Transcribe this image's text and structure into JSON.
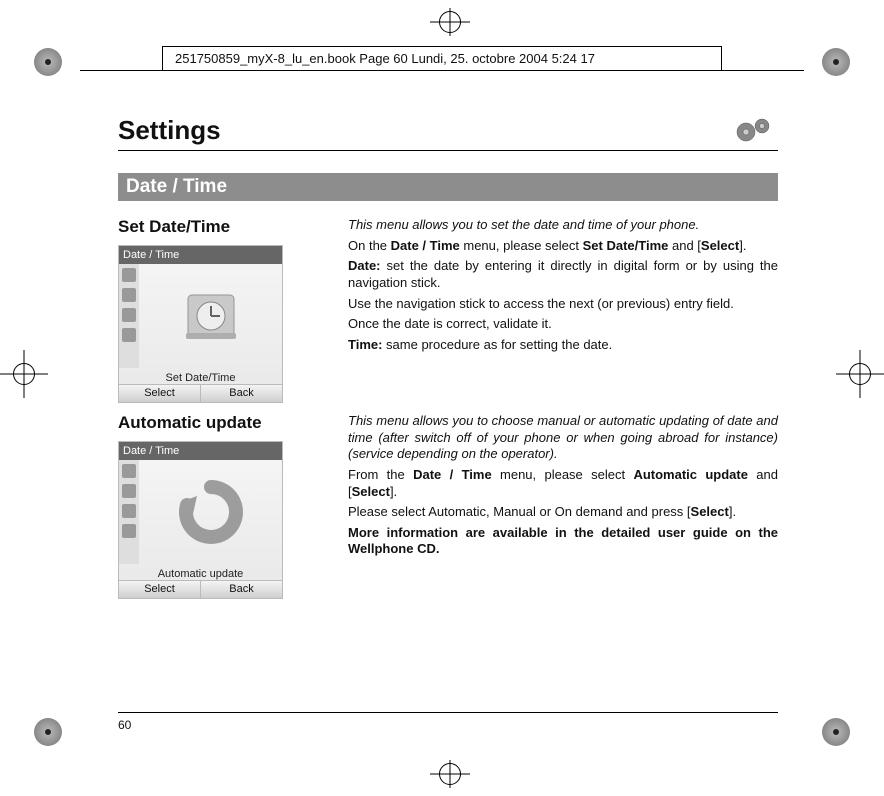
{
  "header": {
    "running_head": "251750859_myX-8_lu_en.book  Page 60  Lundi, 25. octobre 2004  5:24 17"
  },
  "page": {
    "title": "Settings",
    "number": "60"
  },
  "section": {
    "title": "Date / Time"
  },
  "set_date_time": {
    "heading": "Set Date/Time",
    "phone_title": "Date / Time",
    "phone_caption": "Set Date/Time",
    "soft_left": "Select",
    "soft_right": "Back",
    "p_intro": "This menu allows you to set the date and time of your phone.",
    "p_on_pre": "On the ",
    "p_on_menu": "Date / Time",
    "p_on_mid": " menu, please select ",
    "p_on_sel": "Set Date/Time",
    "p_on_and": " and [",
    "p_on_btn": "Select",
    "p_on_end": "].",
    "p_date_label": "Date:",
    "p_date_body": " set the date by entering it directly in digital form or by using the navigation stick.",
    "p_nav": "Use the navigation stick to access the next (or previous) entry field.",
    "p_validate": "Once the date is correct, validate it.",
    "p_time_label": "Time:",
    "p_time_body": " same procedure as for setting the date."
  },
  "auto_update": {
    "heading": "Automatic update",
    "phone_title": "Date / Time",
    "phone_caption": "Automatic update",
    "soft_left": "Select",
    "soft_right": "Back",
    "p_intro": "This menu allows you to choose manual or automatic updating of date and time (after switch off of your phone or when going abroad for instance) (service depending on the operator).",
    "p_from_pre": "From the ",
    "p_from_menu": "Date / Time",
    "p_from_mid": " menu, please select ",
    "p_from_sel": "Automatic update",
    "p_from_and": " and [",
    "p_from_btn": "Select",
    "p_from_end": "].",
    "p_please_pre": "Please select Automatic, Manual or On demand and press [",
    "p_please_btn": "Select",
    "p_please_end": "].",
    "more_info": "More information are available in the detailed user guide on the Wellphone CD."
  }
}
